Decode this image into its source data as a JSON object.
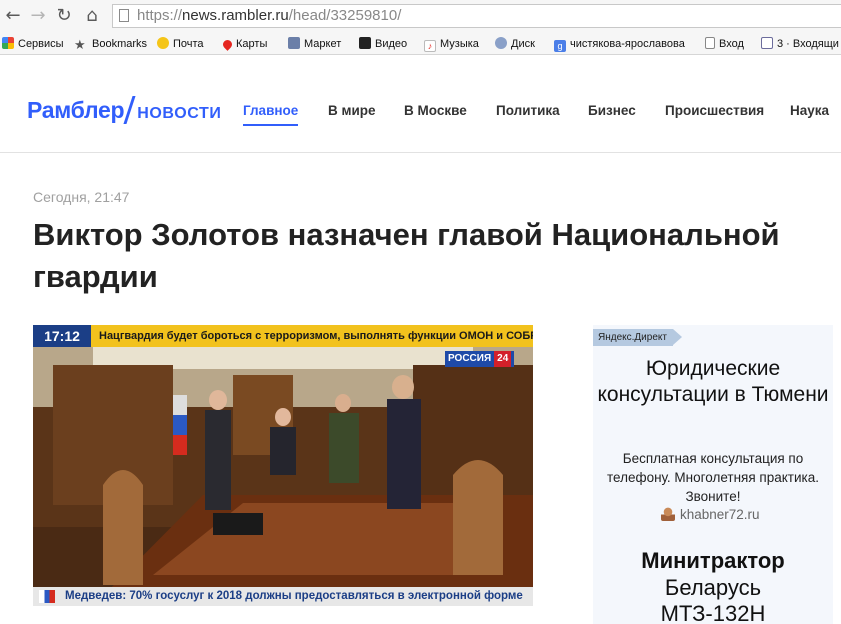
{
  "browser": {
    "url_scheme": "https://",
    "url_host": "news.rambler.ru",
    "url_path": "/head/33259810/",
    "bookmarks": [
      {
        "label": "Сервисы",
        "icon": "apps-grid-icon"
      },
      {
        "label": "Bookmarks",
        "icon": "star-icon"
      },
      {
        "label": "Почта",
        "icon": "mail-smiley-icon"
      },
      {
        "label": "Карты",
        "icon": "map-pin-icon"
      },
      {
        "label": "Маркет",
        "icon": "market-icon"
      },
      {
        "label": "Видео",
        "icon": "video-icon"
      },
      {
        "label": "Музыка",
        "icon": "music-icon"
      },
      {
        "label": "Диск",
        "icon": "disk-icon"
      },
      {
        "label": "чистякова-ярославова",
        "icon": "google-icon"
      },
      {
        "label": "Вход",
        "icon": "page-icon"
      },
      {
        "label": "3 · Входящи",
        "icon": "inbox-icon"
      }
    ]
  },
  "site": {
    "brand": "Рамблер",
    "section": "НОВОСТИ",
    "nav": [
      {
        "label": "Главное",
        "active": true
      },
      {
        "label": "В мире",
        "active": false
      },
      {
        "label": "В Москве",
        "active": false
      },
      {
        "label": "Политика",
        "active": false
      },
      {
        "label": "Бизнес",
        "active": false
      },
      {
        "label": "Происшествия",
        "active": false
      },
      {
        "label": "Наука",
        "active": false
      }
    ],
    "accent_color": "#315efb"
  },
  "article": {
    "timestamp": "Сегодня, 21:47",
    "headline": "Виктор Золотов назначен главой Национальной гвардии",
    "video": {
      "clock": "17:12",
      "top_ticker": "Нацгвардия будет бороться с терроризмом, выполнять функции ОМОН и СОБР",
      "channel_name": "РОССИЯ",
      "channel_number": "24",
      "bottom_ticker": "Медведев: 70% госуслуг к 2018 должны предоставляться в электронной форме"
    }
  },
  "ad": {
    "label": "Яндекс.Директ",
    "title": "Юридические консультации в Тюмени",
    "text": "Бесплатная консультация по телефону. Многолетняя практика. Звоните!",
    "domain": "khabner72.ru",
    "second_title": "Минитрактор",
    "second_subtitle": "Беларусь МТЗ-132Н"
  }
}
